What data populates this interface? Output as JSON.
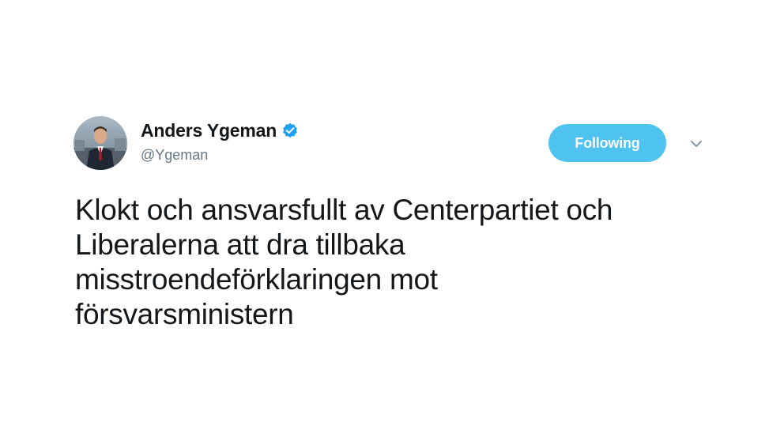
{
  "user": {
    "display_name": "Anders Ygeman",
    "handle": "@Ygeman",
    "verified": true,
    "avatar_icon": "profile-photo"
  },
  "follow_button": {
    "label": "Following",
    "color": "#4fc3f0"
  },
  "menu": {
    "icon": "chevron-down-icon"
  },
  "tweet": {
    "text": "Klokt och ansvarsfullt av Centerpartiet och\nLiberalerna att dra tillbaka\nmisstroendeförklaringen mot\nförsvarsministern"
  },
  "colors": {
    "verified_badge": "#1da1f2",
    "text_primary": "#14171a",
    "text_secondary": "#657786"
  }
}
